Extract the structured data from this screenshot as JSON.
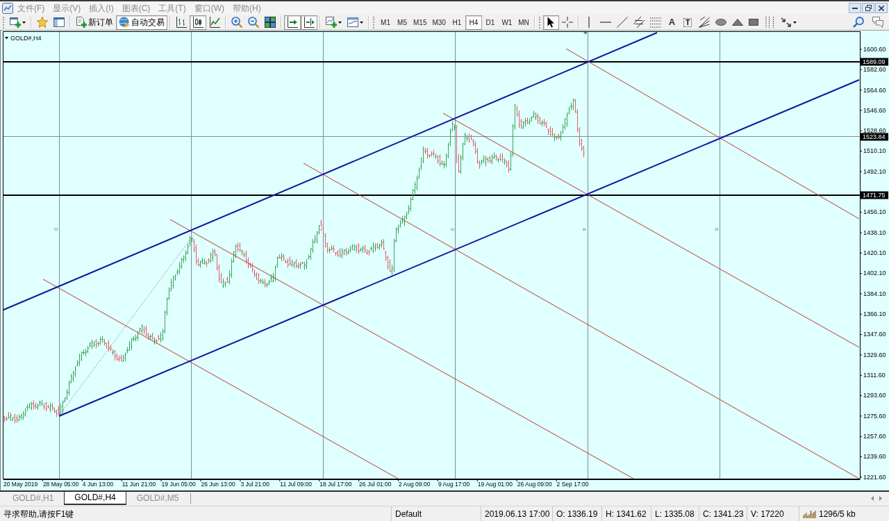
{
  "menu_bar": {
    "items": [
      "文件(F)",
      "显示(V)",
      "插入(I)",
      "图表(C)",
      "工具(T)",
      "窗口(W)",
      "帮助(H)"
    ]
  },
  "toolbar": {
    "groups": [
      {
        "grip": true,
        "items": [
          {
            "kind": "newchart",
            "pressed": false,
            "dropdown": true
          }
        ]
      },
      {
        "items": [
          {
            "kind": "favorites",
            "pressed": false
          },
          {
            "kind": "navigator",
            "pressed": false
          }
        ]
      },
      {
        "items": [
          {
            "kind": "order",
            "label": "新订单",
            "pressed": false
          },
          {
            "kind": "autotrade",
            "label": "自动交易",
            "pressed": true
          }
        ]
      },
      {
        "items": [
          {
            "kind": "bars",
            "pressed": false
          },
          {
            "kind": "candles",
            "pressed": true
          },
          {
            "kind": "line",
            "pressed": false
          }
        ]
      },
      {
        "items": [
          {
            "kind": "zoomin",
            "pressed": false
          },
          {
            "kind": "zoomout",
            "pressed": false
          },
          {
            "kind": "tile",
            "pressed": false
          }
        ]
      },
      {
        "items": [
          {
            "kind": "autoscroll",
            "pressed": true
          },
          {
            "kind": "shift",
            "pressed": true
          }
        ]
      },
      {
        "items": [
          {
            "kind": "indicators",
            "pressed": false,
            "dropdown": true
          },
          {
            "kind": "templates",
            "pressed": false,
            "dropdown": true
          }
        ]
      },
      {
        "grip": true,
        "items": [
          {
            "kind": "timeframe",
            "label": "M1",
            "pressed": false
          },
          {
            "kind": "timeframe",
            "label": "M5",
            "pressed": false
          },
          {
            "kind": "timeframe",
            "label": "M15",
            "pressed": false
          },
          {
            "kind": "timeframe",
            "label": "M30",
            "pressed": false
          },
          {
            "kind": "timeframe",
            "label": "H1",
            "pressed": false
          },
          {
            "kind": "timeframe",
            "label": "H4",
            "pressed": true
          },
          {
            "kind": "timeframe",
            "label": "D1",
            "pressed": false
          },
          {
            "kind": "timeframe",
            "label": "W1",
            "pressed": false
          },
          {
            "kind": "timeframe",
            "label": "MN",
            "pressed": false
          }
        ]
      },
      {
        "grip": true,
        "items": [
          {
            "kind": "cursor",
            "pressed": true
          },
          {
            "kind": "crosshair",
            "pressed": false
          }
        ]
      },
      {
        "items": [
          {
            "kind": "vline",
            "pressed": false
          },
          {
            "kind": "hline",
            "pressed": false
          },
          {
            "kind": "trend",
            "pressed": false
          },
          {
            "kind": "channel",
            "pressed": false
          },
          {
            "kind": "fibo",
            "pressed": false
          },
          {
            "kind": "text",
            "label": "A",
            "pressed": false
          },
          {
            "kind": "label",
            "label": "T",
            "pressed": false
          },
          {
            "kind": "pitchfork",
            "pressed": false
          },
          {
            "kind": "ellipse",
            "pressed": false
          },
          {
            "kind": "triangle",
            "pressed": false
          },
          {
            "kind": "rectangle",
            "pressed": false
          },
          {
            "kind": "timezones",
            "pressed": false
          },
          {
            "kind": "arrows",
            "pressed": false,
            "dropdown": true
          }
        ]
      }
    ]
  },
  "toolbar_end": [
    {
      "kind": "search"
    },
    {
      "kind": "chat"
    }
  ],
  "chart": {
    "title": "GOLD#,H4",
    "price_labels": [
      "1600.60",
      "1582.60",
      "1564.60",
      "1546.60",
      "1528.60",
      "1510.10",
      "1492.10",
      "1456.10",
      "1438.10",
      "1420.10",
      "1402.10",
      "1384.10",
      "1366.10",
      "1347.60",
      "1329.60",
      "1311.60",
      "1293.60",
      "1275.60",
      "1257.60",
      "1239.60",
      "1221.60"
    ],
    "price_tags": [
      "1589.09",
      "1523.84",
      "1471.75"
    ],
    "time_labels": [
      "20 May 2019",
      "28 May 05:00",
      "4 Jun 13:00",
      "11 Jun 21:00",
      "19 Jun 05:00",
      "26 Jun 13:00",
      "3 Jul 21:00",
      "11 Jul 09:00",
      "18 Jul 17:00",
      "26 Jul 01:00",
      "2 Aug 09:00",
      "9 Aug 17:00",
      "19 Aug 01:00",
      "26 Aug 09:00",
      "2 Sep 17:00"
    ],
    "zone_labels": [
      "0",
      "2",
      "3",
      "4",
      "5"
    ]
  },
  "tabs": [
    {
      "label": "GOLD#,H1",
      "selected": false
    },
    {
      "label": "GOLD#,H4",
      "selected": true
    },
    {
      "label": "GOLD#,M5",
      "selected": false
    }
  ],
  "status_bar": {
    "help": "寻求帮助,请按F1键",
    "profile": "Default",
    "time": "2019.06.13 17:00",
    "open": "O: 1336.19",
    "high": "H: 1341.62",
    "low": "L: 1335.08",
    "close": "C: 1341.23",
    "volume": "V: 17220",
    "traffic": "1296/5 kb"
  }
}
